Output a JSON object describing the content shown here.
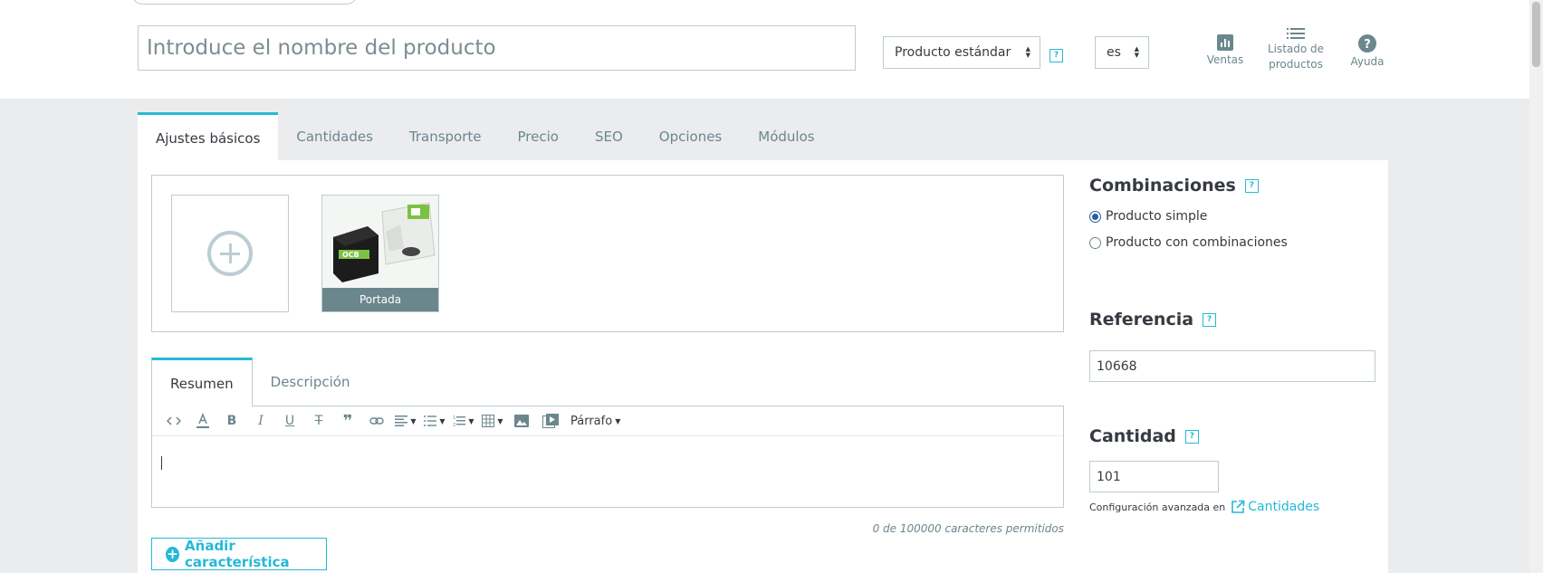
{
  "header": {
    "name_placeholder": "Introduce el nombre del producto",
    "product_type": "Producto estándar",
    "language": "es",
    "help_glyph": "?",
    "tools": {
      "ventas": "Ventas",
      "listado_line1": "Listado de",
      "listado_line2": "productos",
      "ayuda": "Ayuda"
    }
  },
  "tabs": [
    "Ajustes básicos",
    "Cantidades",
    "Transporte",
    "Precio",
    "SEO",
    "Opciones",
    "Módulos"
  ],
  "images": {
    "cover_label": "Portada"
  },
  "description": {
    "tabs": [
      "Resumen",
      "Descripción"
    ],
    "paragraph_format": "Párrafo",
    "char_count": "0 de 100000 caracteres permitidos"
  },
  "add_feature_label": "Añadir característica",
  "side": {
    "combinations_title": "Combinaciones",
    "radio_simple": "Producto simple",
    "radio_combinations": "Producto con combinaciones",
    "reference_title": "Referencia",
    "reference_value": "10668",
    "quantity_title": "Cantidad",
    "quantity_value": "101",
    "advanced_text": "Configuración avanzada en",
    "advanced_link": "Cantidades"
  },
  "colors": {
    "accent": "#25b9d7",
    "text": "#363a41",
    "muted": "#6c868e",
    "border": "#bbcdd2",
    "background": "#eaecee"
  }
}
